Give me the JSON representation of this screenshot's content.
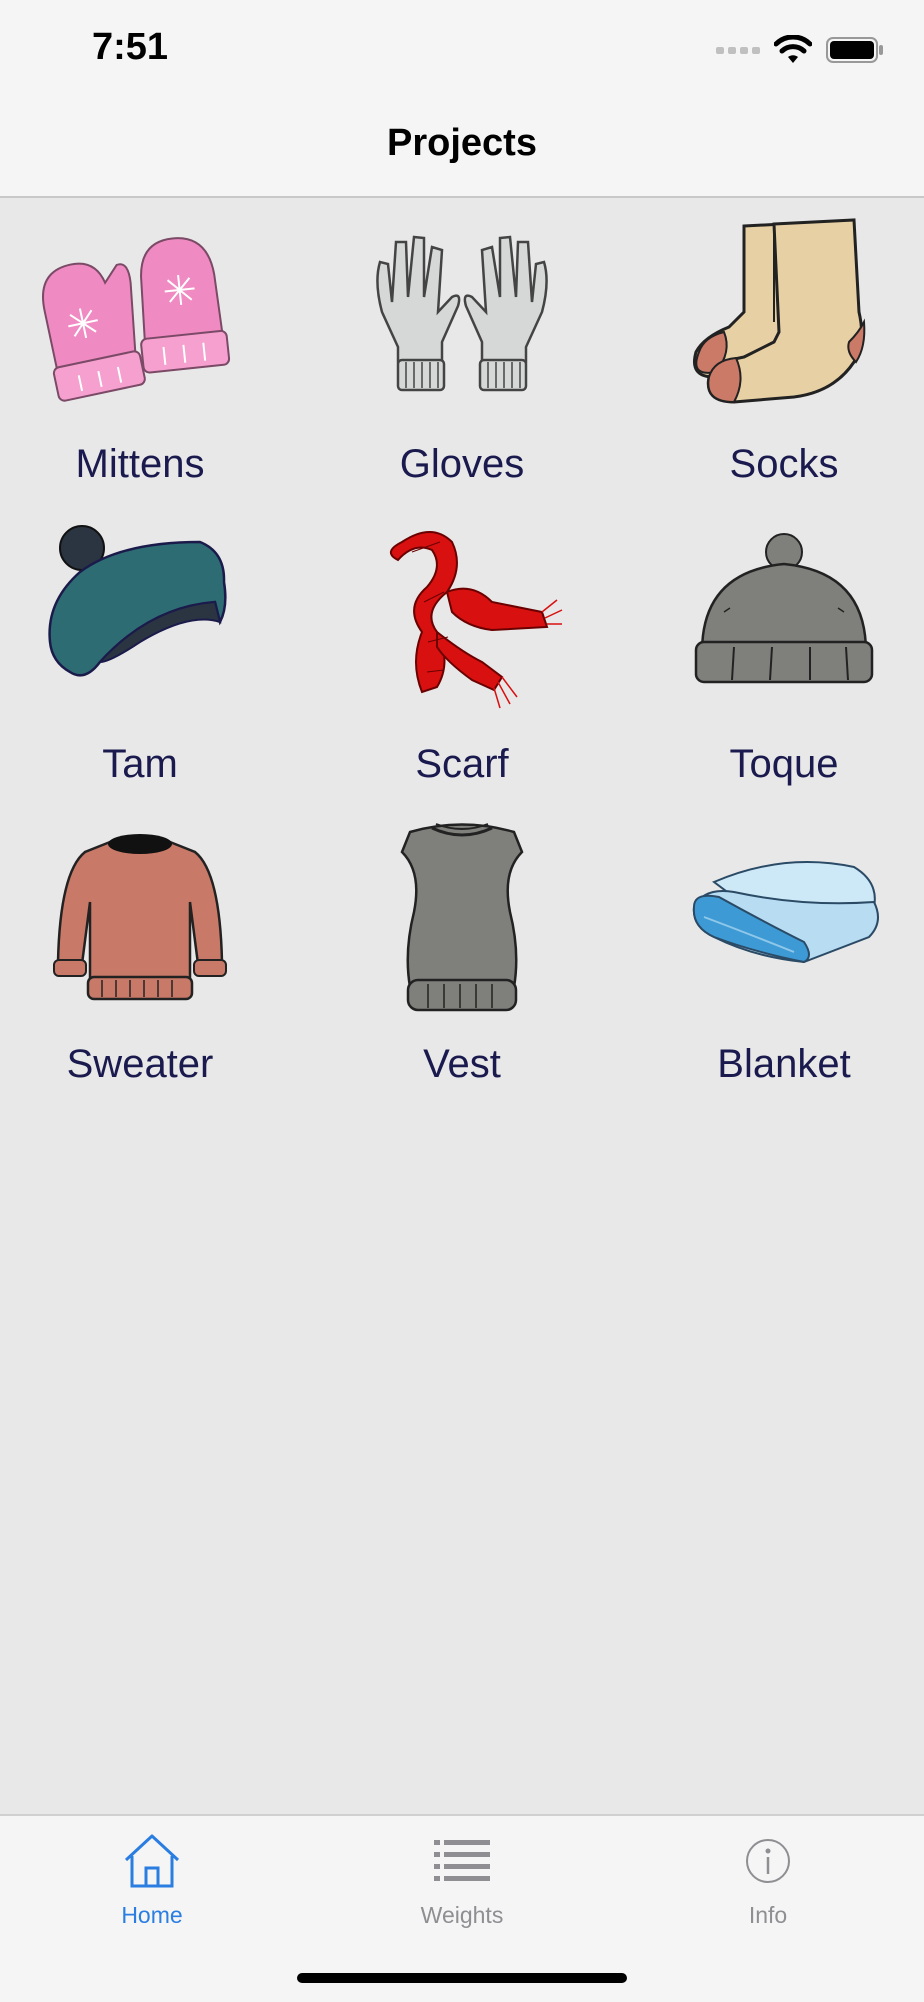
{
  "status": {
    "time": "7:51"
  },
  "nav": {
    "title": "Projects"
  },
  "projects": [
    {
      "label": "Mittens",
      "icon": "mittens-icon"
    },
    {
      "label": "Gloves",
      "icon": "gloves-icon"
    },
    {
      "label": "Socks",
      "icon": "socks-icon"
    },
    {
      "label": "Tam",
      "icon": "tam-icon"
    },
    {
      "label": "Scarf",
      "icon": "scarf-icon"
    },
    {
      "label": "Toque",
      "icon": "toque-icon"
    },
    {
      "label": "Sweater",
      "icon": "sweater-icon"
    },
    {
      "label": "Vest",
      "icon": "vest-icon"
    },
    {
      "label": "Blanket",
      "icon": "blanket-icon"
    }
  ],
  "tabs": [
    {
      "label": "Home",
      "icon": "home-icon",
      "selected": true
    },
    {
      "label": "Weights",
      "icon": "list-icon",
      "selected": false
    },
    {
      "label": "Info",
      "icon": "info-icon",
      "selected": false
    }
  ],
  "colors": {
    "accent": "#2a7de1",
    "inactive": "#8e8e93",
    "label": "#1a1a4e"
  }
}
